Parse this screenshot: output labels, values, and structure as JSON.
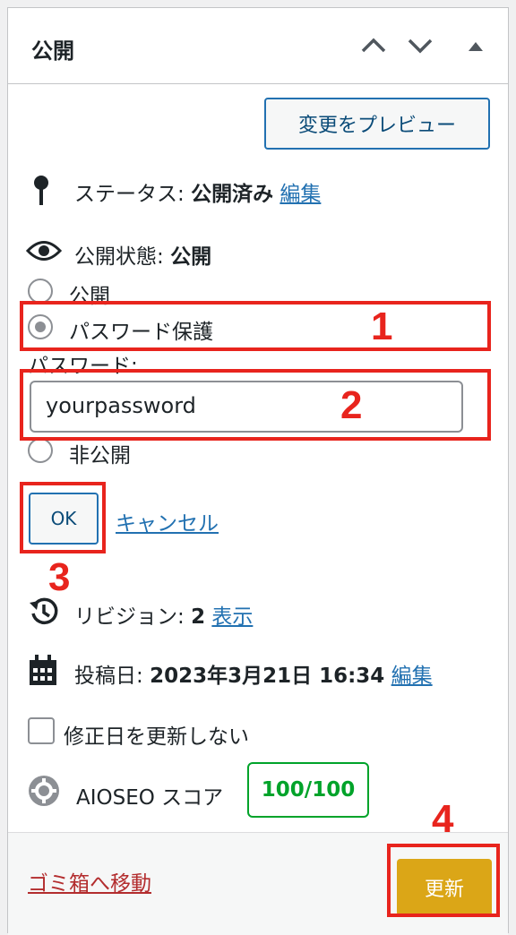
{
  "header": {
    "title": "公開"
  },
  "preview_button": "変更をプレビュー",
  "status": {
    "label": "ステータス:",
    "value": "公開済み",
    "edit": "編集"
  },
  "visibility": {
    "label": "公開状態:",
    "value": "公開",
    "options": [
      "公開",
      "パスワード保護",
      "非公開"
    ],
    "password_label": "パスワード:",
    "password_value": "yourpassword",
    "ok": "OK",
    "cancel": "キャンセル"
  },
  "revisions": {
    "label": "リビジョン:",
    "count": "2",
    "link": "表示"
  },
  "publish_date": {
    "label": "投稿日:",
    "value": "2023年3月21日 16:34",
    "edit": "編集"
  },
  "no_modified_checkbox": "修正日を更新しない",
  "aioseo": {
    "label": "AIOSEO スコア",
    "score": "100/100"
  },
  "footer": {
    "trash": "ゴミ箱へ移動",
    "update": "更新"
  },
  "annotations": [
    "1",
    "2",
    "3",
    "4"
  ],
  "colors": {
    "annotation": "#e8241d",
    "link": "#2271b1",
    "score": "#00a32a",
    "update": "#dba617",
    "trash": "#b32d2e"
  }
}
